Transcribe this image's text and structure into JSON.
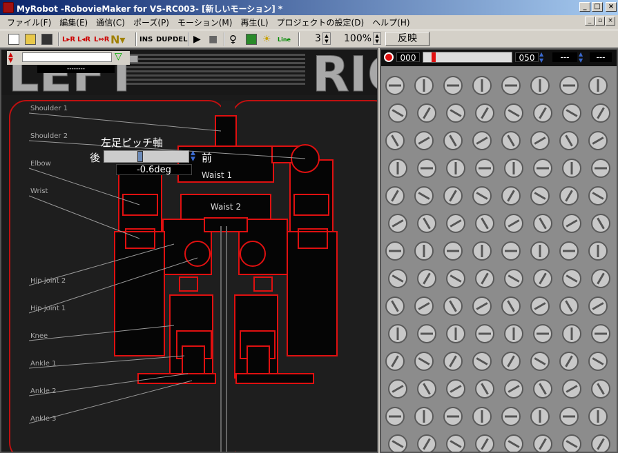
{
  "window": {
    "title": "MyRobot -RobovieMaker for VS-RC003- [新しいモーション] *",
    "min_label": "_",
    "max_label": "□",
    "close_label": "×"
  },
  "menu": [
    {
      "id": "file",
      "label": "ファイル(F)"
    },
    {
      "id": "edit",
      "label": "編集(E)"
    },
    {
      "id": "comm",
      "label": "通信(C)"
    },
    {
      "id": "pose",
      "label": "ポーズ(P)"
    },
    {
      "id": "motion",
      "label": "モーション(M)"
    },
    {
      "id": "play",
      "label": "再生(L)"
    },
    {
      "id": "project",
      "label": "プロジェクトの設定(D)"
    },
    {
      "id": "help",
      "label": "ヘルプ(H)"
    }
  ],
  "mdi": {
    "min": "_",
    "restore": "▫",
    "close": "×"
  },
  "toolbar": {
    "lr1": "L▸R",
    "lr2": "L◂R",
    "lr3": "L⇔R",
    "ins": "INS",
    "dup": "DUP",
    "del": "DEL",
    "line": "Line",
    "step_value": "3",
    "zoom_value": "100%",
    "apply_label": "反映"
  },
  "left_view": {
    "big_letters_left": "LEFT",
    "big_letters_right": "RIG",
    "joint_labels": [
      "Shoulder 1",
      "Shoulder 2",
      "Elbow",
      "Wrist",
      "Hip joint 2",
      "Hip joint 1",
      "Knee",
      "Ankle 1",
      "Ankle 2",
      "Ankle 3"
    ],
    "waist1": "Waist 1",
    "waist2": "Waist 2",
    "top_field_value": "--------"
  },
  "joint_popup": {
    "name": "左足ピッチ軸",
    "back_label": "後",
    "front_label": "前",
    "value": "-0.6deg",
    "level": 0.42
  },
  "right_view": {
    "counter": "000",
    "speed": "050",
    "field2": "---",
    "field3": "---",
    "slider_level": 0.1
  },
  "colors": {
    "accent_red": "#e01010",
    "panel_dark": "#151515"
  }
}
